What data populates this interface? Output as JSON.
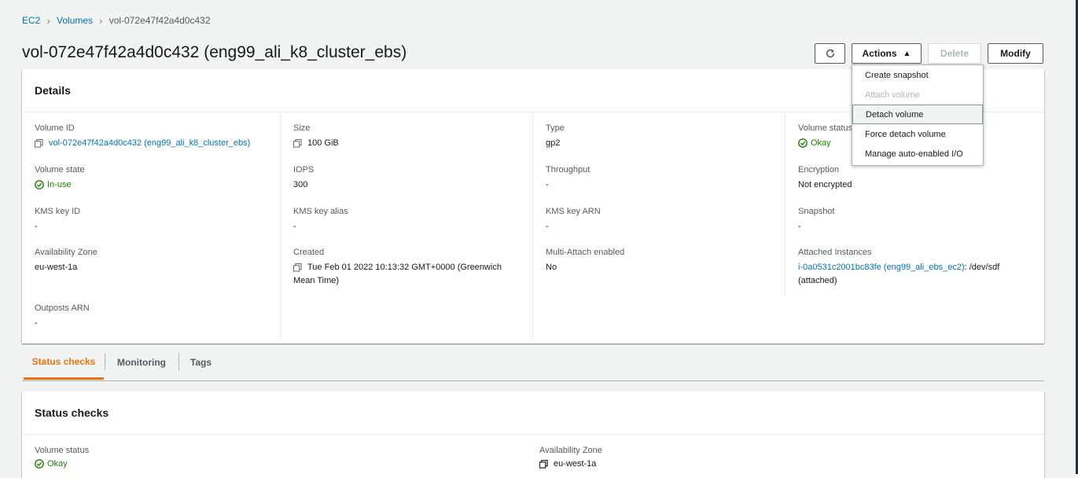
{
  "breadcrumb": {
    "ec2": "EC2",
    "volumes": "Volumes",
    "current": "vol-072e47f42a4d0c432"
  },
  "page": {
    "title": "vol-072e47f42a4d0c432 (eng99_ali_k8_cluster_ebs)"
  },
  "toolbar": {
    "refresh_icon": "refresh-icon",
    "actions_label": "Actions",
    "delete_label": "Delete",
    "modify_label": "Modify"
  },
  "actions_menu": {
    "items": [
      {
        "label": "Create snapshot",
        "state": "enabled"
      },
      {
        "label": "Attach volume",
        "state": "disabled"
      },
      {
        "label": "Detach volume",
        "state": "highlighted"
      },
      {
        "label": "Force detach volume",
        "state": "enabled"
      },
      {
        "label": "Manage auto-enabled I/O",
        "state": "enabled"
      }
    ]
  },
  "details": {
    "header": "Details",
    "volume_id": {
      "label": "Volume ID",
      "value": "vol-072e47f42a4d0c432 (eng99_ali_k8_cluster_ebs)"
    },
    "volume_state": {
      "label": "Volume state",
      "value": "In-use"
    },
    "kms_key_id": {
      "label": "KMS key ID",
      "value": "-"
    },
    "availability_zone": {
      "label": "Availability Zone",
      "value": "eu-west-1a"
    },
    "outposts_arn": {
      "label": "Outposts ARN",
      "value": "-"
    },
    "size": {
      "label": "Size",
      "value": "100 GiB"
    },
    "iops": {
      "label": "IOPS",
      "value": "300"
    },
    "kms_key_alias": {
      "label": "KMS key alias",
      "value": "-"
    },
    "created": {
      "label": "Created",
      "value_line1": "Tue Feb 01 2022 10:13:32 GMT+0000 (Greenwich",
      "value_line2": "Mean Time)"
    },
    "type": {
      "label": "Type",
      "value": "gp2"
    },
    "throughput": {
      "label": "Throughput",
      "value": "-"
    },
    "kms_key_arn": {
      "label": "KMS key ARN",
      "value": "-"
    },
    "multi_attach": {
      "label": "Multi-Attach enabled",
      "value": "No"
    },
    "volume_status": {
      "label": "Volume status",
      "value": "Okay"
    },
    "encryption": {
      "label": "Encryption",
      "value": "Not encrypted"
    },
    "snapshot": {
      "label": "Snapshot",
      "value": "-"
    },
    "attached_instances": {
      "label": "Attached Instances",
      "link": "i-0a0531c2001bc83fe (eng99_ali_ebs_ec2)",
      "suffix": ": /dev/sdf",
      "line2": "(attached)"
    }
  },
  "tabs": [
    {
      "label": "Status checks",
      "active": true
    },
    {
      "label": "Monitoring",
      "active": false
    },
    {
      "label": "Tags",
      "active": false
    }
  ],
  "status_checks": {
    "header": "Status checks",
    "volume_status": {
      "label": "Volume status",
      "value": "Okay"
    },
    "availability_zone": {
      "label": "Availability Zone",
      "value": "eu-west-1a"
    }
  },
  "colors": {
    "link": "#0073bb",
    "ok": "#1d8102",
    "active_tab": "#ec7211",
    "background": "#f2f3f3"
  }
}
